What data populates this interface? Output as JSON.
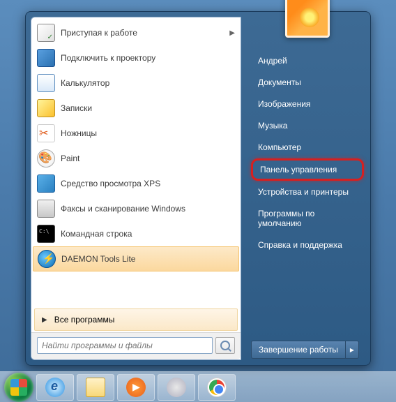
{
  "left": {
    "items": [
      {
        "label": "Приступая к работе",
        "icon": "ic-checklist",
        "arrow": true
      },
      {
        "label": "Подключить к проектору",
        "icon": "ic-projector"
      },
      {
        "label": "Калькулятор",
        "icon": "ic-calc"
      },
      {
        "label": "Записки",
        "icon": "ic-notes"
      },
      {
        "label": "Ножницы",
        "icon": "ic-snip"
      },
      {
        "label": "Paint",
        "icon": "ic-paint"
      },
      {
        "label": "Средство просмотра XPS",
        "icon": "ic-xps"
      },
      {
        "label": "Факсы и сканирование Windows",
        "icon": "ic-fax"
      },
      {
        "label": "Командная строка",
        "icon": "ic-cmd"
      },
      {
        "label": "DAEMON Tools Lite",
        "icon": "ic-daemon",
        "highlight": true
      }
    ],
    "all_programs": "Все программы",
    "search_placeholder": "Найти программы и файлы"
  },
  "right": {
    "links": [
      "Андрей",
      "Документы",
      "Изображения",
      "Музыка",
      "Компьютер",
      "Панель управления",
      "Устройства и принтеры",
      "Программы по умолчанию",
      "Справка и поддержка"
    ],
    "highlighted_index": 5,
    "shutdown": "Завершение работы"
  },
  "taskbar": {
    "items": [
      "ic-ie",
      "ic-explorer",
      "ic-wmp",
      "ic-steam",
      "ic-chrome"
    ]
  }
}
